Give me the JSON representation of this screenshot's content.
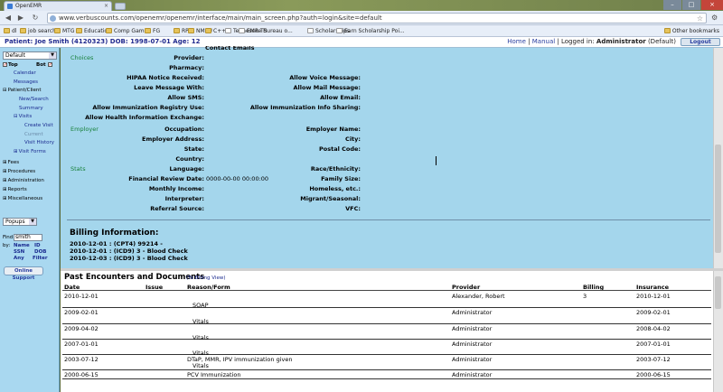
{
  "browser": {
    "tab_title": "OpenEMR",
    "url": "www.verbuscounts.com/openemr/openemr/interface/main/main_screen.php?auth=login&site=default",
    "bookmarks": [
      "dl",
      "job search",
      "MTG",
      "Education",
      "Comp Game",
      "FG",
      "RPG",
      "NMSU",
      "C++",
      "Tennessee Bureau o...",
      "EMR TS",
      "Scholarships",
      "Earn Scholarship Poi..."
    ],
    "other_bookmarks": "Other bookmarks"
  },
  "header": {
    "patient": "Patient: Joe Smith (4120323) DOB: 1998-07-01 Age: 12",
    "home": "Home",
    "manual": "Manual",
    "logged_in_as": "Logged in:",
    "user": "Administrator",
    "site": "(Default)",
    "logout": "Logout"
  },
  "leftnav": {
    "select_value": "Default",
    "top": "Top",
    "bot": "Bot",
    "items": [
      {
        "label": "Calendar",
        "indent": 2
      },
      {
        "label": "Messages",
        "indent": 2
      },
      {
        "label": "Patient/Client",
        "indent": 0,
        "tree": "⊟"
      },
      {
        "label": "New/Search",
        "indent": 3
      },
      {
        "label": "Summary",
        "indent": 3
      },
      {
        "label": "Visits",
        "indent": 2,
        "tree": "⊟"
      },
      {
        "label": "Create Visit",
        "indent": 4
      },
      {
        "label": "Current",
        "indent": 4,
        "dim": true
      },
      {
        "label": "Visit History",
        "indent": 4
      },
      {
        "label": "Visit Forms",
        "indent": 2,
        "tree": "⊞"
      },
      {
        "label": "Fees",
        "indent": 0,
        "tree": "⊞"
      },
      {
        "label": "Procedures",
        "indent": 0,
        "tree": "⊞"
      },
      {
        "label": "Administration",
        "indent": 0,
        "tree": "⊞"
      },
      {
        "label": "Reports",
        "indent": 0,
        "tree": "⊞"
      },
      {
        "label": "Miscellaneous",
        "indent": 0,
        "tree": "⊞"
      }
    ],
    "popups": "Popups",
    "find_label": "Find:",
    "find_value": "smith",
    "by_label": "by:",
    "find_by": [
      "Name",
      "ID",
      "SSN",
      "DOB",
      "Any",
      "Filter"
    ],
    "support": "Online Support"
  },
  "demographics": {
    "partial_top": "Contact Emails",
    "sections": {
      "choices": "Choices",
      "employer": "Employer",
      "stats": "Stats"
    },
    "choices_left": [
      "Provider:",
      "Pharmacy:",
      "HIPAA Notice Received:",
      "Leave Message With:",
      "Allow SMS:",
      "Allow Immunization Registry Use:",
      "Allow Health Information Exchange:"
    ],
    "choices_right": [
      "Allow Voice Message:",
      "Allow Mail Message:",
      "Allow Email:",
      "Allow Immunization Info Sharing:"
    ],
    "employer_left": [
      "Occupation:",
      "Employer Address:",
      "State:",
      "Country:"
    ],
    "employer_right": [
      "Employer Name:",
      "City:",
      "Postal Code:"
    ],
    "stats_left": [
      "Language:",
      "Financial Review Date:",
      "Monthly Income:",
      "Interpreter:",
      "Referral Source:"
    ],
    "stats_right": [
      "Race/Ethnicity:",
      "Family Size:",
      "Homeless, etc.:",
      "Migrant/Seasonal:",
      "VFC:"
    ],
    "financial_review_value": "0000-00-00 00:00:00"
  },
  "billing": {
    "title": "Billing Information:",
    "lines": [
      "2010-12-01 : (CPT4) 99214 -",
      "2010-12-01 : (ICD9) 3 - Blood Check",
      "2010-12-03 : (ICD9) 3 - Blood Check"
    ]
  },
  "encounters": {
    "title": "Past Encounters and Documents",
    "billing_view_link": "(To Billing View)",
    "columns": [
      "Date",
      "Issue",
      "Reason/Form",
      "Provider",
      "Billing",
      "Insurance"
    ],
    "rows": [
      {
        "date": "2010-12-01",
        "reason": "",
        "form": "SOAP",
        "provider": "Alexander, Robert",
        "billing": "3",
        "insurance": "2010-12-01"
      },
      {
        "date": "2009-02-01",
        "reason": "",
        "form": "Vitals",
        "provider": "Administrator",
        "billing": "",
        "insurance": "2009-02-01"
      },
      {
        "date": "2009-04-02",
        "reason": "",
        "form": "Vitals",
        "provider": "Administrator",
        "billing": "",
        "insurance": "2008-04-02"
      },
      {
        "date": "2007-01-01",
        "reason": "",
        "form": "Vitals",
        "provider": "Administrator",
        "billing": "",
        "insurance": "2007-01-01"
      },
      {
        "date": "2003-07-12",
        "reason": "DTaP, MMR, IPV immunization given",
        "form": "Vitals",
        "provider": "Administrator",
        "billing": "",
        "insurance": "2003-07-12"
      },
      {
        "date": "2000-06-15",
        "reason": "PCV Immunization",
        "form": "",
        "provider": "Administrator",
        "billing": "",
        "insurance": "2000-06-15"
      }
    ]
  }
}
